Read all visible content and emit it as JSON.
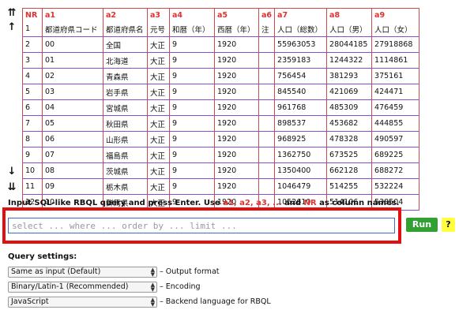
{
  "nav": {
    "top": "⇈",
    "up": "↑",
    "down": "↓",
    "bottom": "⇊"
  },
  "table": {
    "headers": [
      "NR",
      "a1",
      "a2",
      "a3",
      "a4",
      "a5",
      "a6",
      "a7",
      "a8",
      "a9"
    ],
    "rows": [
      [
        "1",
        "都道府県コード",
        "都道府県名",
        "元号",
        "和暦（年）",
        "西暦（年）",
        "注",
        "人口（総数）",
        "人口（男）",
        "人口（女）"
      ],
      [
        "2",
        "00",
        "全国",
        "大正",
        "9",
        "1920",
        "",
        "55963053",
        "28044185",
        "27918868"
      ],
      [
        "3",
        "01",
        "北海道",
        "大正",
        "9",
        "1920",
        "",
        "2359183",
        "1244322",
        "1114861"
      ],
      [
        "4",
        "02",
        "青森県",
        "大正",
        "9",
        "1920",
        "",
        "756454",
        "381293",
        "375161"
      ],
      [
        "5",
        "03",
        "岩手県",
        "大正",
        "9",
        "1920",
        "",
        "845540",
        "421069",
        "424471"
      ],
      [
        "6",
        "04",
        "宮城県",
        "大正",
        "9",
        "1920",
        "",
        "961768",
        "485309",
        "476459"
      ],
      [
        "7",
        "05",
        "秋田県",
        "大正",
        "9",
        "1920",
        "",
        "898537",
        "453682",
        "444855"
      ],
      [
        "8",
        "06",
        "山形県",
        "大正",
        "9",
        "1920",
        "",
        "968925",
        "478328",
        "490597"
      ],
      [
        "9",
        "07",
        "福島県",
        "大正",
        "9",
        "1920",
        "",
        "1362750",
        "673525",
        "689225"
      ],
      [
        "10",
        "08",
        "茨城県",
        "大正",
        "9",
        "1920",
        "",
        "1350400",
        "662128",
        "688272"
      ],
      [
        "11",
        "09",
        "栃木県",
        "大正",
        "9",
        "1920",
        "",
        "1046479",
        "514255",
        "532224"
      ],
      [
        "12",
        "10",
        "群馬県",
        "大正",
        "9",
        "1920",
        "",
        "1052610",
        "514106",
        "538504"
      ]
    ]
  },
  "query": {
    "label_prefix": "Input SQL-like RBQL query and press Enter. Use ",
    "label_cols": "a1, a2, a3, ...",
    "label_and": " and ",
    "label_nr": "NR",
    "label_suffix": " as column names.",
    "placeholder": "select ... where ... order by ... limit ...",
    "value": "",
    "run_label": "Run",
    "help_label": "?"
  },
  "settings": {
    "title": "Query settings:",
    "items": [
      {
        "selected": "Same as input (Default)",
        "desc": "– Output format"
      },
      {
        "selected": "Binary/Latin-1 (Recommended)",
        "desc": "– Encoding"
      },
      {
        "selected": "JavaScript",
        "desc": "– Backend language for RBQL"
      }
    ]
  },
  "colors": {
    "accent_red": "#e0322e",
    "highlight_border": "#e01010",
    "run_button": "#33a033",
    "help_button": "#ffff40",
    "row_border": "#8a4fd1"
  }
}
